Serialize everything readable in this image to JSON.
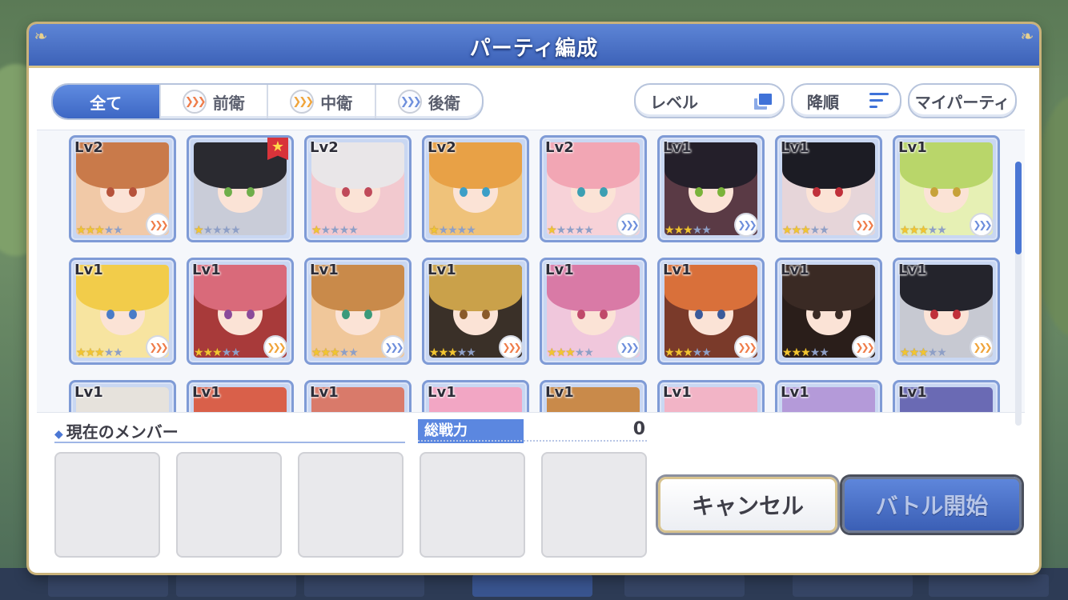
{
  "dialog": {
    "title": "パーティ編成"
  },
  "filters": {
    "tabs": [
      {
        "label": "全て",
        "active": true,
        "icon": ""
      },
      {
        "label": "前衛",
        "active": false,
        "icon": "front-position-icon"
      },
      {
        "label": "中衛",
        "active": false,
        "icon": "middle-position-icon"
      },
      {
        "label": "後衛",
        "active": false,
        "icon": "back-position-icon"
      }
    ],
    "sort_field_label": "レベル",
    "sort_order_label": "降順",
    "my_party_label": "マイパーティ"
  },
  "units": [
    {
      "level": "Lv2",
      "stars": 3,
      "role": "front",
      "favorite": false,
      "hair": "#c97a4a",
      "bg": "#f1c9a7",
      "eye": "#b6523a"
    },
    {
      "level": "",
      "stars": 1,
      "role": "",
      "favorite": true,
      "hair": "#2a2a30",
      "bg": "#c9ccd8",
      "eye": "#6fae4a"
    },
    {
      "level": "Lv2",
      "stars": 1,
      "role": "",
      "favorite": false,
      "hair": "#e9e6e8",
      "bg": "#f2c9cf",
      "eye": "#c04a5a"
    },
    {
      "level": "Lv2",
      "stars": 1,
      "role": "",
      "favorite": false,
      "hair": "#e8a146",
      "bg": "#efc27a",
      "eye": "#3c9fc7"
    },
    {
      "level": "Lv2",
      "stars": 1,
      "role": "back",
      "favorite": false,
      "hair": "#f2a6b4",
      "bg": "#f7d2d8",
      "eye": "#3c9fb2"
    },
    {
      "level": "Lv1",
      "stars": 3,
      "role": "back",
      "favorite": false,
      "hair": "#241f2a",
      "bg": "#5a3a45",
      "eye": "#7ab33a"
    },
    {
      "level": "Lv1",
      "stars": 3,
      "role": "front",
      "favorite": false,
      "hair": "#1c1c24",
      "bg": "#e6d5d9",
      "eye": "#c0303a"
    },
    {
      "level": "Lv1",
      "stars": 3,
      "role": "back",
      "favorite": false,
      "hair": "#b9d66a",
      "bg": "#e6f0b4",
      "eye": "#c7a23a"
    },
    {
      "level": "Lv1",
      "stars": 3,
      "role": "front",
      "favorite": false,
      "hair": "#f2cc4a",
      "bg": "#f7e4a0",
      "eye": "#4a7cc7"
    },
    {
      "level": "Lv1",
      "stars": 3,
      "role": "mid",
      "favorite": false,
      "hair": "#d96a7a",
      "bg": "#a83a3a",
      "eye": "#8a4a9a"
    },
    {
      "level": "Lv1",
      "stars": 3,
      "role": "back",
      "favorite": false,
      "hair": "#c98a4a",
      "bg": "#f0c79a",
      "eye": "#3a9a7a"
    },
    {
      "level": "Lv1",
      "stars": 3,
      "role": "front",
      "favorite": false,
      "hair": "#caa14a",
      "bg": "#3a3028",
      "eye": "#8a5a2a"
    },
    {
      "level": "Lv1",
      "stars": 3,
      "role": "back",
      "favorite": false,
      "hair": "#d97aa6",
      "bg": "#f0c7dc",
      "eye": "#c04a6a"
    },
    {
      "level": "Lv1",
      "stars": 3,
      "role": "front",
      "favorite": false,
      "hair": "#d9703a",
      "bg": "#7a3a2a",
      "eye": "#3a5a9a"
    },
    {
      "level": "Lv1",
      "stars": 3,
      "role": "front",
      "favorite": false,
      "hair": "#3a2a24",
      "bg": "#2a1e1a",
      "eye": "#3a2a24"
    },
    {
      "level": "Lv1",
      "stars": 3,
      "role": "mid",
      "favorite": false,
      "hair": "#24242c",
      "bg": "#c7c9d2",
      "eye": "#c0303a"
    },
    {
      "level": "Lv1",
      "stars": 0,
      "role": "",
      "favorite": false,
      "hair": "#e6e2dc",
      "bg": "#c9c7c2",
      "eye": "#888"
    },
    {
      "level": "Lv1",
      "stars": 0,
      "role": "",
      "favorite": false,
      "hair": "#d9604a",
      "bg": "#f0b4a4",
      "eye": "#888"
    },
    {
      "level": "Lv1",
      "stars": 0,
      "role": "",
      "favorite": false,
      "hair": "#d97a6a",
      "bg": "#f2c2a8",
      "eye": "#888"
    },
    {
      "level": "Lv1",
      "stars": 0,
      "role": "",
      "favorite": false,
      "hair": "#f2a6c4",
      "bg": "#f7d6e4",
      "eye": "#888"
    },
    {
      "level": "Lv1",
      "stars": 0,
      "role": "",
      "favorite": false,
      "hair": "#c98a4a",
      "bg": "#e4b48a",
      "eye": "#888"
    },
    {
      "level": "Lv1",
      "stars": 0,
      "role": "",
      "favorite": false,
      "hair": "#f2b4c6",
      "bg": "#f7dbe4",
      "eye": "#888"
    },
    {
      "level": "Lv1",
      "stars": 0,
      "role": "",
      "favorite": false,
      "hair": "#b49ad9",
      "bg": "#e0d2f0",
      "eye": "#888"
    },
    {
      "level": "Lv1",
      "stars": 0,
      "role": "",
      "favorite": false,
      "hair": "#6a6ab4",
      "bg": "#c7c9e6",
      "eye": "#888"
    }
  ],
  "members": {
    "label": "現在のメンバー",
    "slots": 5
  },
  "power": {
    "label": "総戦力",
    "value": "0"
  },
  "buttons": {
    "cancel": "キャンセル",
    "start": "バトル開始"
  },
  "colors": {
    "accent": "#3d62b8",
    "gold": "#d9c48a",
    "star": "#f2c531"
  }
}
